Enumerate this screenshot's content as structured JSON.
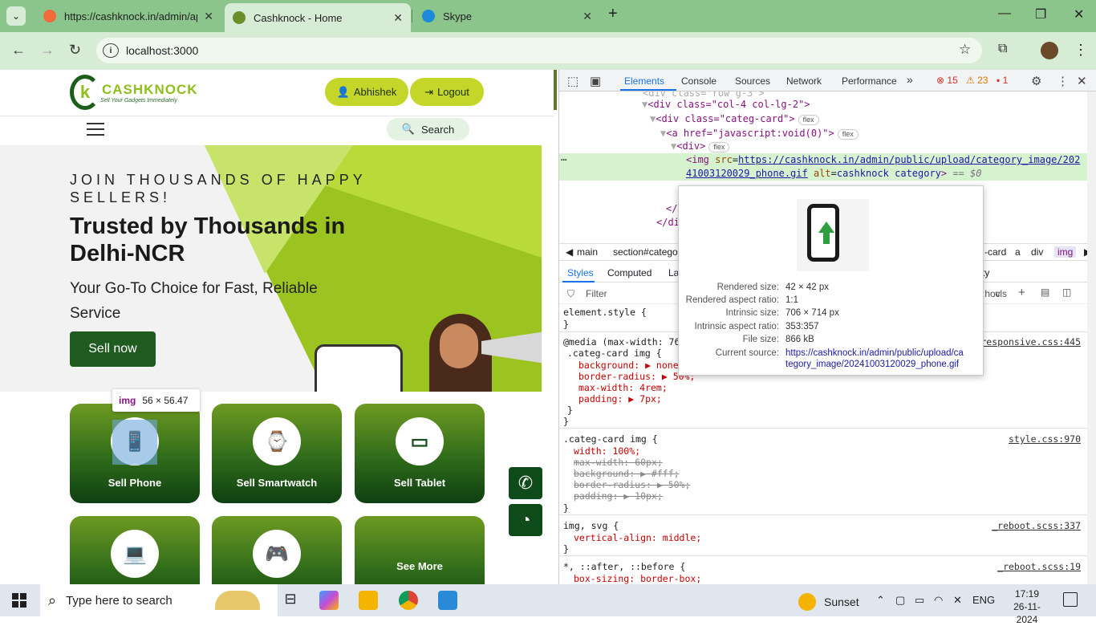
{
  "browser": {
    "tabs": [
      {
        "title": "https://cashknock.in/admin/api",
        "favicon_color": "#f26b3a"
      },
      {
        "title": "Cashknock - Home",
        "favicon_color": "#6a8f2a"
      },
      {
        "title": "Skype",
        "favicon_color": "#1c8ad8"
      }
    ],
    "url": "localhost:3000",
    "icons": {
      "back": "arrow-left-icon",
      "forward": "arrow-right-icon",
      "reload": "reload-icon",
      "star": "star-icon",
      "extensions": "puzzle-icon",
      "menu": "kebab-icon"
    }
  },
  "site": {
    "logo_name": "CASHKNOCK",
    "logo_tagline": "Sell Your Gadgets Immediately",
    "user_button": "Abhishek",
    "logout_button": "Logout",
    "search_button": "Search",
    "hero": {
      "eyebrow": "JOIN THOUSANDS OF HAPPY SELLERS!",
      "title": "Trusted by Thousands in Delhi-NCR",
      "subtitle": "Your Go-To Choice for Fast, Reliable Service",
      "cta": "Sell now"
    },
    "categories": [
      {
        "label": "Sell Phone",
        "icon": "phone-icon"
      },
      {
        "label": "Sell Smartwatch",
        "icon": "smartwatch-icon"
      },
      {
        "label": "Sell Tablet",
        "icon": "tablet-icon"
      },
      {
        "label": "",
        "icon": "laptop-icon"
      },
      {
        "label": "",
        "icon": "gadget-icon"
      },
      {
        "label": "See More",
        "icon": ""
      }
    ],
    "inspect_tooltip": {
      "tag": "img",
      "size": "56 × 56.47"
    }
  },
  "devtools": {
    "tabs": [
      "Elements",
      "Console",
      "Sources",
      "Network",
      "Performance"
    ],
    "errors": "15",
    "warnings": "23",
    "issues": "1",
    "dom_lines": [
      {
        "text": "<div class=\"col-4 col-lg-2\">"
      },
      {
        "text": "<div class=\"categ-card\">",
        "badge": "flex"
      },
      {
        "text": "<a href=\"javascript:void(0)\">",
        "badge": "flex"
      },
      {
        "text": "<div>",
        "badge": "flex"
      }
    ],
    "selected_img_src": "https://cashknock.in/admin/public/upload/category_image/20241003120029_phone.gif",
    "selected_img_alt": "cashknock category",
    "selected_suffix": "== $0",
    "breadcrumbs": [
      "main",
      "section#catego",
      "-card",
      "a",
      "div",
      "img"
    ],
    "style_tabs": [
      "Styles",
      "Computed",
      "La",
      "ty"
    ],
    "filter_placeholder": "Filter",
    "cls_label": ".cls",
    "rules": [
      {
        "selector": "element.style {",
        "close": "}"
      },
      {
        "media": "@media (max-width: 768",
        "selector": ".categ-card img {",
        "source": "responsive.css:445",
        "props": [
          "background: ▶ none;",
          "border-radius: ▶ 50%;",
          "max-width: 4rem;",
          "padding: ▶ 7px;"
        ]
      },
      {
        "selector": ".categ-card img {",
        "source": "style.css:970",
        "props": [
          "width: 100%;",
          "max-width: 60px;",
          "background: ▶ #fff;",
          "border-radius: ▶ 50%;",
          "padding: ▶ 10px;"
        ]
      },
      {
        "selector": "img, svg {",
        "source": "_reboot.scss:337",
        "props": [
          "vertical-align: middle;"
        ]
      },
      {
        "selector": "*, ::after, ::before {",
        "source": "_reboot.scss:19",
        "props": [
          "box-sizing: border-box;"
        ]
      }
    ],
    "preview": {
      "rows": [
        {
          "k": "Rendered size:",
          "v": "42 × 42 px"
        },
        {
          "k": "Rendered aspect ratio:",
          "v": "1:1"
        },
        {
          "k": "Intrinsic size:",
          "v": "706 × 714 px"
        },
        {
          "k": "Intrinsic aspect ratio:",
          "v": "353:357"
        },
        {
          "k": "File size:",
          "v": "866 kB"
        },
        {
          "k": "Current source:",
          "v": "https://cashknock.in/admin/public/upload/ca"
        },
        {
          "k": "",
          "v": "tegory_image/20241003120029_phone.gif"
        }
      ]
    }
  },
  "taskbar": {
    "search_placeholder": "Type here to search",
    "weather": "Sunset",
    "language": "ENG",
    "time": "17:19",
    "date": "26-11-2024"
  }
}
